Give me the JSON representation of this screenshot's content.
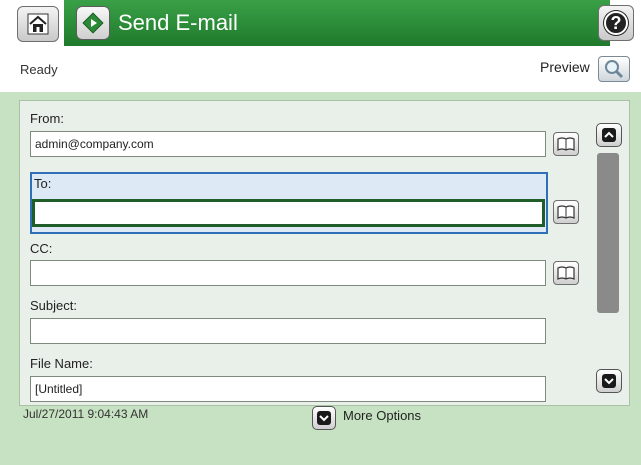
{
  "header": {
    "title": "Send E-mail",
    "home_icon": "home-icon",
    "title_icon": "send-diamond-icon",
    "help_icon": "help-icon",
    "help_glyph": "?"
  },
  "status": {
    "text": "Ready",
    "preview_label": "Preview"
  },
  "form": {
    "from": {
      "label": "From:",
      "value": "admin@company.com"
    },
    "to": {
      "label": "To:",
      "value": ""
    },
    "cc": {
      "label": "CC:",
      "value": ""
    },
    "subject": {
      "label": "Subject:",
      "value": ""
    },
    "file_name": {
      "label": "File Name:",
      "value": "[Untitled]"
    }
  },
  "footer": {
    "datetime": "Jul/27/2011 9:04:43 AM",
    "more_options": "More Options"
  },
  "colors": {
    "title_bar": "#2a8a36",
    "panel": "#c7e2c2",
    "focus_frame": "#2e6fb5",
    "focus_input": "#1f5e29"
  }
}
